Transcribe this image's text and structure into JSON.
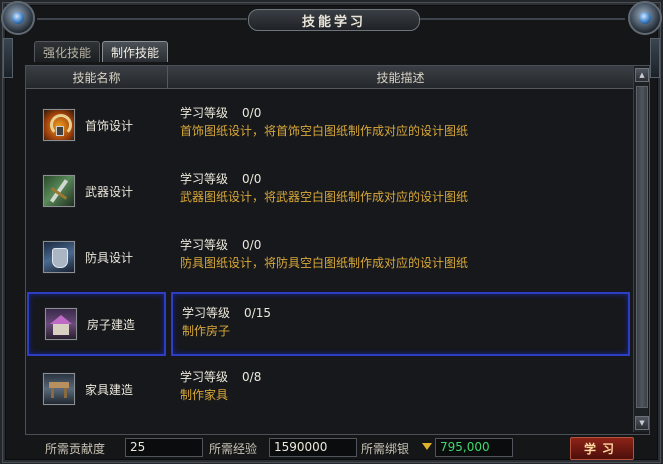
{
  "window": {
    "title": "技能学习"
  },
  "tabs": [
    {
      "label": "强化技能",
      "active": false
    },
    {
      "label": "制作技能",
      "active": true
    }
  ],
  "table": {
    "headers": {
      "name": "技能名称",
      "desc": "技能描述"
    },
    "level_label": "学习等级",
    "rows": [
      {
        "name": "首饰设计",
        "level": "0/0",
        "desc": "首饰图纸设计，将首饰空白图纸制作成对应的设计图纸",
        "icon": "necklace-icon",
        "selected": false
      },
      {
        "name": "武器设计",
        "level": "0/0",
        "desc": "武器图纸设计，将武器空白图纸制作成对应的设计图纸",
        "icon": "weapon-icon",
        "selected": false
      },
      {
        "name": "防具设计",
        "level": "0/0",
        "desc": "防具图纸设计，将防具空白图纸制作成对应的设计图纸",
        "icon": "armor-icon",
        "selected": false
      },
      {
        "name": "房子建造",
        "level": "0/15",
        "desc": "制作房子",
        "icon": "house-icon",
        "selected": true
      },
      {
        "name": "家具建造",
        "level": "0/8",
        "desc": "制作家具",
        "icon": "furniture-icon",
        "selected": false
      }
    ]
  },
  "footer": {
    "contribution_label": "所需贡献度",
    "contribution_value": "25",
    "exp_label": "所需经验",
    "exp_value": "1590000",
    "silver_label": "所需绑银",
    "silver_value": "795,000",
    "learn_button": "学习"
  },
  "colors": {
    "desc_text": "#d9a83a",
    "selection_border": "#2d3dc4",
    "money": "#3fd86a",
    "button": "#8c2418"
  }
}
